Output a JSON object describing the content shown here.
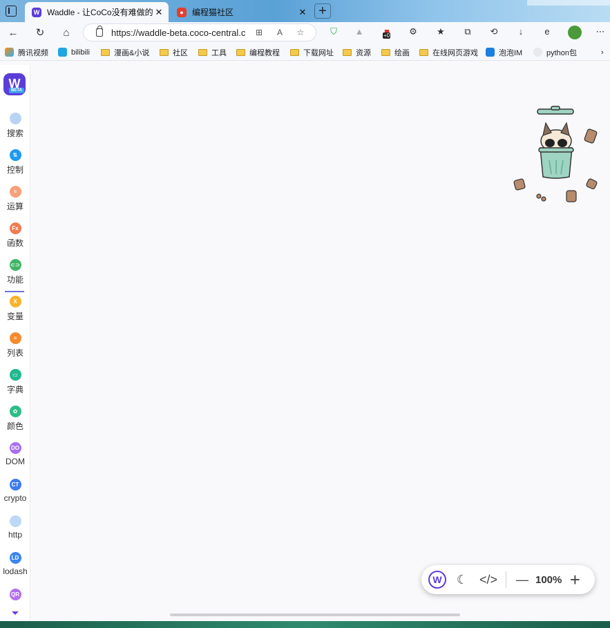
{
  "browser": {
    "tabs": [
      {
        "title": "Waddle - 让CoCo没有难做的控件",
        "close": "✕"
      },
      {
        "title": "编程猫社区",
        "close": "✕"
      }
    ],
    "new_tab": "+",
    "url": "https://waddle-beta.coco-central.cn",
    "ext_badge": "+0"
  },
  "bookmarks": [
    "腾讯视频",
    "bilibili",
    "漫画&小说",
    "社区",
    "工具",
    "编程教程",
    "下载网址",
    "资源",
    "绘画",
    "在线网页游戏",
    "泡泡IM",
    "python包"
  ],
  "sidebar": {
    "logo": "W",
    "logo_badge": "BETA",
    "items": [
      {
        "label": "搜索",
        "icon": "",
        "color": "#b8d4f5"
      },
      {
        "label": "控制",
        "icon": "⇅",
        "color": "#1d9bf0"
      },
      {
        "label": "运算",
        "icon": "=",
        "color": "#f5a07a"
      },
      {
        "label": "函数",
        "icon": "Fx",
        "color": "#f07b52"
      },
      {
        "label": "功能",
        "icon": "⊂⊃",
        "color": "#3fb564"
      },
      {
        "label": "变量",
        "icon": "X",
        "color": "#f7b32b"
      },
      {
        "label": "列表",
        "icon": "≡",
        "color": "#f78b2b"
      },
      {
        "label": "字典",
        "icon": "▭",
        "color": "#21b98e"
      },
      {
        "label": "颜色",
        "icon": "✿",
        "color": "#2bbd88"
      },
      {
        "label": "DOM",
        "icon": "DO",
        "color": "#a86ef0"
      },
      {
        "label": "crypto",
        "icon": "CT",
        "color": "#3d7bf0"
      },
      {
        "label": "http",
        "icon": "",
        "color": "#bcd8f7"
      },
      {
        "label": "lodash",
        "icon": "LD",
        "color": "#3b86f0"
      },
      {
        "label": "",
        "icon": "QR",
        "color": "#b46ef0"
      }
    ]
  },
  "zoom": {
    "value": "100%",
    "minus": "—",
    "plus": "+"
  }
}
